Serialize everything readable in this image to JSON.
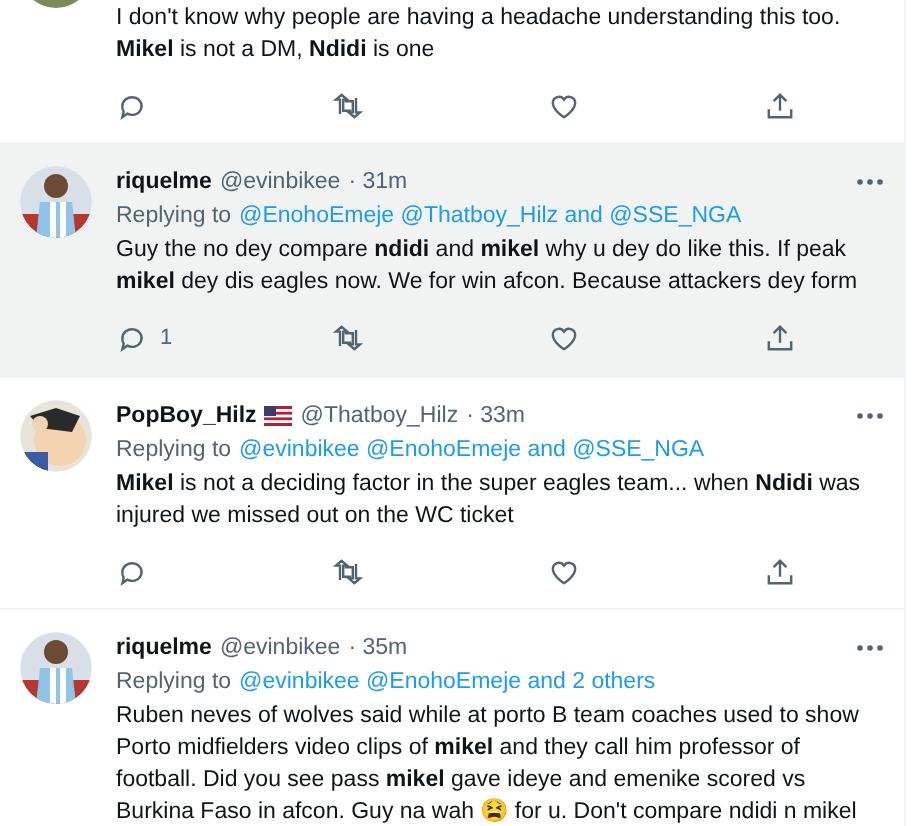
{
  "tweets": [
    {
      "highlighted": false,
      "text": "I don't know why people are having a headache understanding this too. **Mikel** is not a DM, **Ndidi** is one",
      "actions": true
    },
    {
      "highlighted": true,
      "name": "riquelme",
      "handle": "@evinbikee",
      "time": "· 31m",
      "replying_prefix": "Replying to",
      "replying_to": "@EnohoEmeje @Thatboy_Hilz and @SSE_NGA",
      "text": "Guy the no dey compare **ndidi** and **mikel** why u dey do like this. If peak **mikel** dey dis eagles now. We for win afcon. Because attackers dey form",
      "actions": true,
      "reply_count": "1"
    },
    {
      "highlighted": false,
      "name": "PopBoy_Hilz",
      "flag": true,
      "handle": "@Thatboy_Hilz",
      "time": "· 33m",
      "replying_prefix": "Replying to",
      "replying_to": "@evinbikee @EnohoEmeje and @SSE_NGA",
      "text": "**Mikel** is not a deciding factor in the super eagles team... when **Ndidi** was injured we missed out on the WC ticket",
      "actions": true
    },
    {
      "highlighted": false,
      "name": "riquelme",
      "handle": "@evinbikee",
      "time": "· 35m",
      "replying_prefix": "Replying to",
      "replying_to": "@evinbikee @EnohoEmeje and 2 others",
      "text": "Ruben neves of wolves said while at porto B team coaches used to show Porto midfielders video clips of **mikel** and they call him professor of football. Did you see pass **mikel** gave ideye and emenike scored vs Burkina Faso in afcon. Guy na wah 😫 for u. Don't compare ndidi n mikel"
    }
  ]
}
